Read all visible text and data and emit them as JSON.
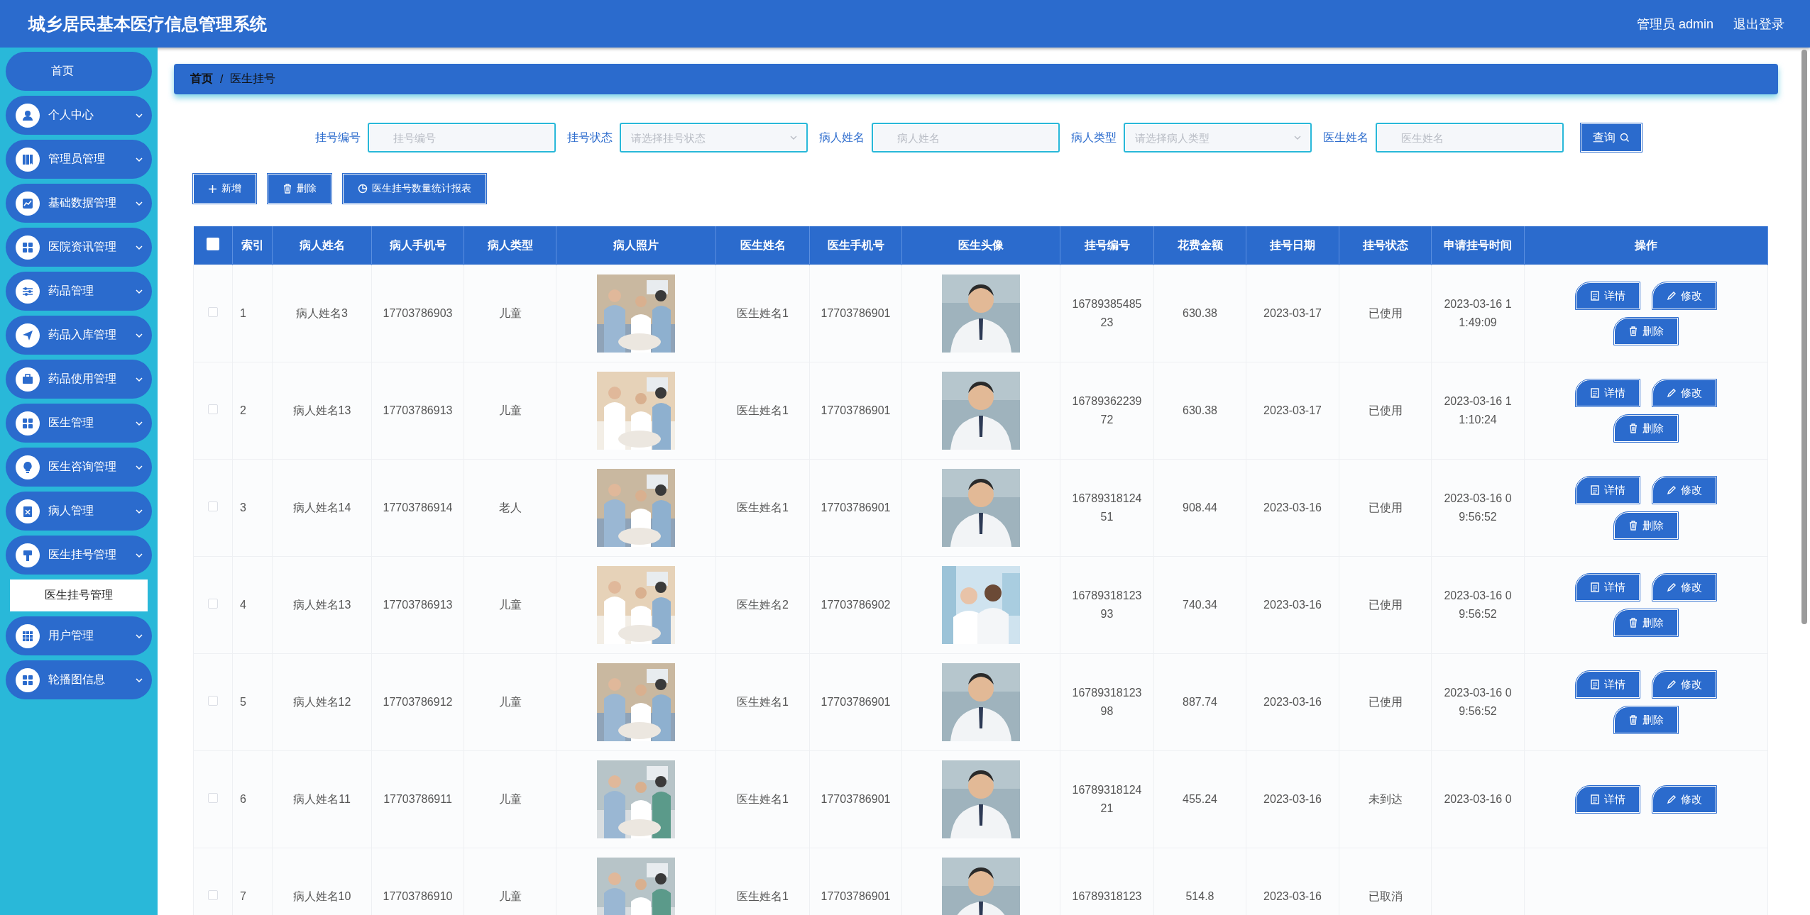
{
  "header": {
    "title": "城乡居民基本医疗信息管理系统",
    "user": "管理员 admin",
    "logout": "退出登录"
  },
  "sidebar": {
    "items": [
      {
        "label": "首页",
        "kind": "link"
      },
      {
        "label": "个人中心",
        "kind": "menu"
      },
      {
        "label": "管理员管理",
        "kind": "menu"
      },
      {
        "label": "基础数据管理",
        "kind": "menu"
      },
      {
        "label": "医院资讯管理",
        "kind": "menu"
      },
      {
        "label": "药品管理",
        "kind": "menu"
      },
      {
        "label": "药品入库管理",
        "kind": "menu"
      },
      {
        "label": "药品使用管理",
        "kind": "menu"
      },
      {
        "label": "医生管理",
        "kind": "menu"
      },
      {
        "label": "医生咨询管理",
        "kind": "menu"
      },
      {
        "label": "病人管理",
        "kind": "menu"
      },
      {
        "label": "医生挂号管理",
        "kind": "menu",
        "children": [
          {
            "label": "医生挂号管理",
            "selected": true
          }
        ]
      },
      {
        "label": "用户管理",
        "kind": "menu"
      },
      {
        "label": "轮播图信息",
        "kind": "menu"
      }
    ]
  },
  "breadcrumb": {
    "items": [
      "首页",
      "医生挂号"
    ],
    "separator": "/"
  },
  "search": {
    "fields": [
      {
        "label": "挂号编号",
        "kind": "text",
        "placeholder": "挂号编号"
      },
      {
        "label": "挂号状态",
        "kind": "select",
        "placeholder": "请选择挂号状态"
      },
      {
        "label": "病人姓名",
        "kind": "text",
        "placeholder": "病人姓名"
      },
      {
        "label": "病人类型",
        "kind": "select",
        "placeholder": "请选择病人类型"
      },
      {
        "label": "医生姓名",
        "kind": "text",
        "placeholder": "医生姓名"
      }
    ],
    "button": "查询"
  },
  "toolbar": [
    "新增",
    "删除",
    "医生挂号数量统计报表"
  ],
  "table": {
    "header_checked": false,
    "columns": [
      "索引",
      "病人姓名",
      "病人手机号",
      "病人类型",
      "病人照片",
      "医生姓名",
      "医生手机号",
      "医生头像",
      "挂号编号",
      "花费金额",
      "挂号日期",
      "挂号状态",
      "申请挂号时间",
      "操作"
    ],
    "rows": [
      {
        "checked": false,
        "index": "1",
        "patient": "病人姓名3",
        "patient_phone": "17703786903",
        "patient_type": "儿童",
        "doctor": "医生姓名1",
        "doctor_phone": "17703786901",
        "number": "1678938548523",
        "amount": "630.38",
        "date": "2023-03-17",
        "status": "已使用",
        "time": "2023-03-16 11:49:09",
        "actions": [
          "详情",
          "修改",
          "删除"
        ]
      },
      {
        "checked": false,
        "index": "2",
        "patient": "病人姓名13",
        "patient_phone": "17703786913",
        "patient_type": "儿童",
        "doctor": "医生姓名1",
        "doctor_phone": "17703786901",
        "number": "1678936223972",
        "amount": "630.38",
        "date": "2023-03-17",
        "status": "已使用",
        "time": "2023-03-16 11:10:24",
        "actions": [
          "详情",
          "修改",
          "删除"
        ]
      },
      {
        "checked": false,
        "index": "3",
        "patient": "病人姓名14",
        "patient_phone": "17703786914",
        "patient_type": "老人",
        "doctor": "医生姓名1",
        "doctor_phone": "17703786901",
        "number": "1678931812451",
        "amount": "908.44",
        "date": "2023-03-16",
        "status": "已使用",
        "time": "2023-03-16 09:56:52",
        "actions": [
          "详情",
          "修改",
          "删除"
        ]
      },
      {
        "checked": false,
        "index": "4",
        "patient": "病人姓名13",
        "patient_phone": "17703786913",
        "patient_type": "儿童",
        "doctor": "医生姓名2",
        "doctor_phone": "17703786902",
        "number": "1678931812393",
        "amount": "740.34",
        "date": "2023-03-16",
        "status": "已使用",
        "time": "2023-03-16 09:56:52",
        "actions": [
          "详情",
          "修改",
          "删除"
        ]
      },
      {
        "checked": false,
        "index": "5",
        "patient": "病人姓名12",
        "patient_phone": "17703786912",
        "patient_type": "儿童",
        "doctor": "医生姓名1",
        "doctor_phone": "17703786901",
        "number": "1678931812398",
        "amount": "887.74",
        "date": "2023-03-16",
        "status": "已使用",
        "time": "2023-03-16 09:56:52",
        "actions": [
          "详情",
          "修改",
          "删除"
        ]
      },
      {
        "checked": false,
        "index": "6",
        "patient": "病人姓名11",
        "patient_phone": "17703786911",
        "patient_type": "儿童",
        "doctor": "医生姓名1",
        "doctor_phone": "17703786901",
        "number": "1678931812421",
        "amount": "455.24",
        "date": "2023-03-16",
        "status": "未到达",
        "time": "2023-03-16 0",
        "actions": [
          "详情",
          "修改"
        ]
      },
      {
        "checked": false,
        "index": "7",
        "patient": "病人姓名10",
        "patient_phone": "17703786910",
        "patient_type": "儿童",
        "doctor": "医生姓名1",
        "doctor_phone": "17703786901",
        "number": "16789318123",
        "amount": "514.8",
        "date": "2023-03-16",
        "status": "已取消"
      }
    ]
  }
}
